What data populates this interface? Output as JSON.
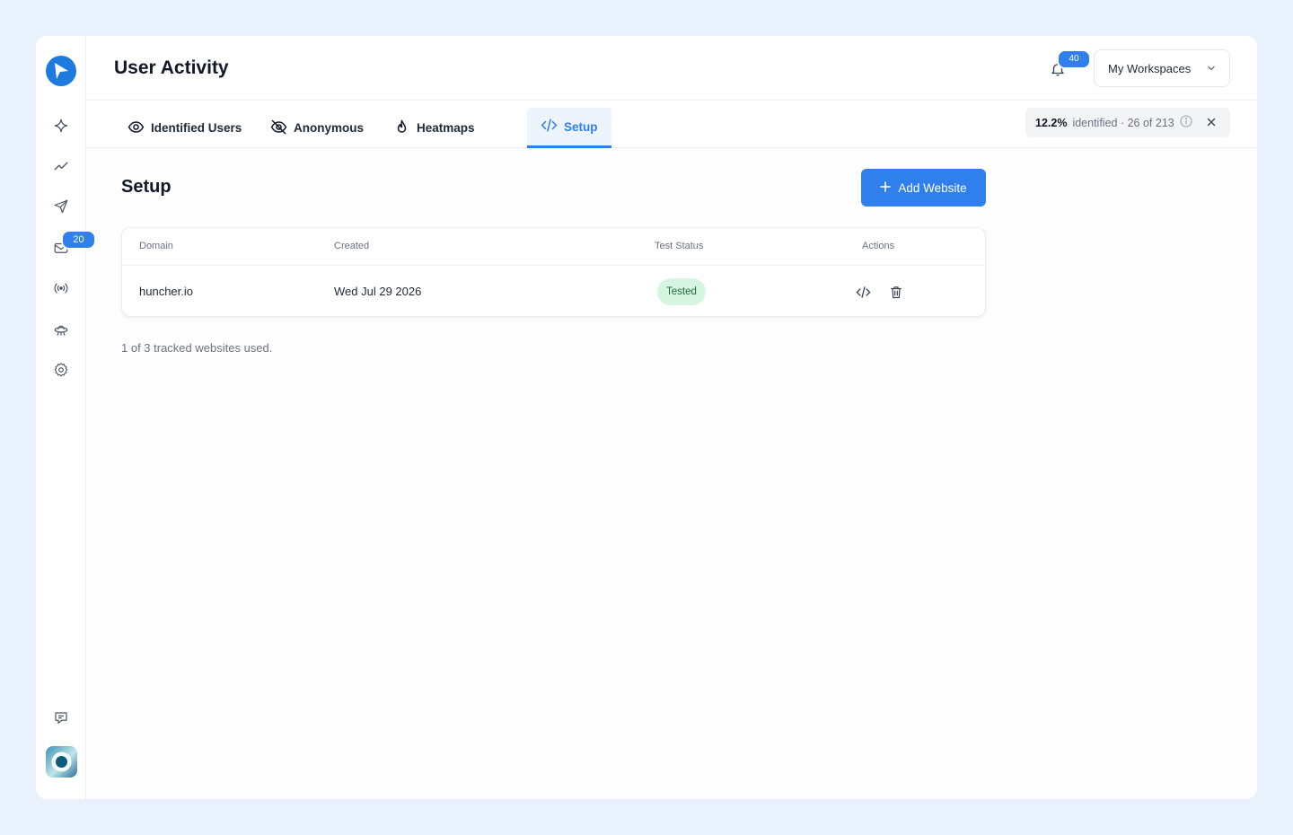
{
  "header": {
    "title": "User Activity",
    "notifications_count": "40",
    "workspace_label": "My Workspaces"
  },
  "sidebar": {
    "items": [
      {
        "icon": "sparkle-icon"
      },
      {
        "icon": "trend-line-icon"
      },
      {
        "icon": "send-icon"
      },
      {
        "icon": "mail-icon",
        "badge": "20"
      },
      {
        "icon": "broadcast-icon"
      },
      {
        "icon": "ufo-icon"
      },
      {
        "icon": "gear-icon"
      }
    ],
    "bottom": [
      {
        "icon": "chat-icon"
      },
      {
        "icon": "avatar"
      }
    ]
  },
  "tabs": [
    {
      "label": "Identified Users",
      "icon": "eye-icon"
    },
    {
      "label": "Anonymous",
      "icon": "eye-off-icon"
    },
    {
      "label": "Heatmaps",
      "icon": "flame-icon"
    },
    {
      "label": "Setup",
      "icon": "code-icon",
      "active": true
    }
  ],
  "stats": {
    "percent": "12.2%",
    "text": "identified · 26 of 213"
  },
  "setup": {
    "title": "Setup",
    "add_button": "Add Website",
    "columns": [
      "Domain",
      "Created",
      "Test Status",
      "Actions"
    ],
    "rows": [
      {
        "domain": "huncher.io",
        "created": "Wed Jul 29 2026",
        "status": "Tested"
      }
    ],
    "footnote": "1 of 3 tracked websites used."
  },
  "colors": {
    "accent": "#2f80ed",
    "tested_bg": "#d6f5e1",
    "tested_text": "#1e6b3a"
  }
}
